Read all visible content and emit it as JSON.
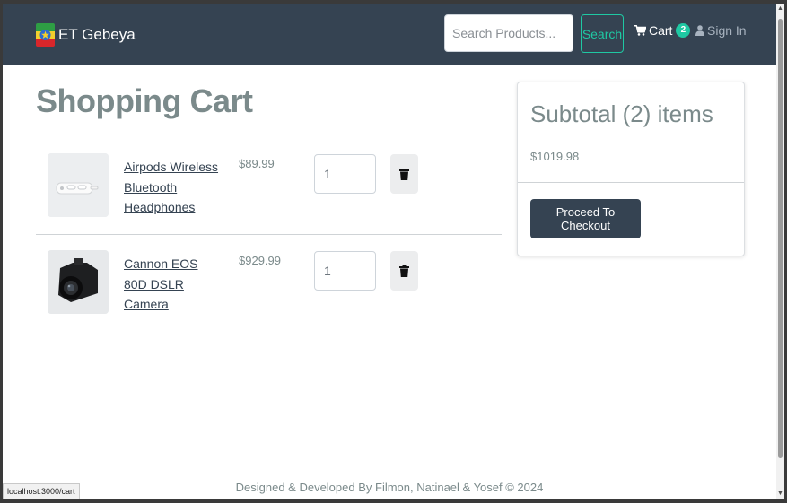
{
  "navbar": {
    "brand": "ET Gebeya",
    "search_placeholder": "Search Products...",
    "search_button": "Search",
    "cart_label": "Cart",
    "cart_count": "2",
    "signin_label": "Sign In",
    "bg_color": "#354352",
    "accent_color": "#1fc8a3"
  },
  "page": {
    "title": "Shopping Cart"
  },
  "cart": {
    "items": [
      {
        "name": "Airpods Wireless Bluetooth Headphones",
        "price": "$89.99",
        "quantity": "1",
        "image_icon": "earbuds-image"
      },
      {
        "name": "Cannon EOS 80D DSLR Camera",
        "price": "$929.99",
        "quantity": "1",
        "image_icon": "camera-image"
      }
    ]
  },
  "summary": {
    "title": "Subtotal (2) items",
    "amount": "$1019.98",
    "checkout_button": "Proceed To Checkout"
  },
  "footer": {
    "text": "Designed & Developed By Filmon, Natinael & Yosef © 2024"
  },
  "status_bar": {
    "url": "localhost:3000/cart"
  }
}
